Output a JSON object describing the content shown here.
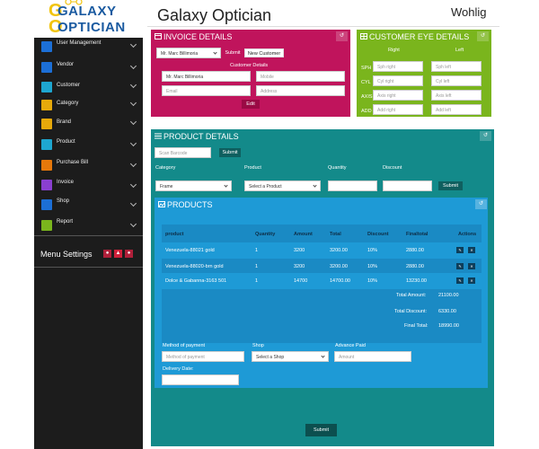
{
  "brand": {
    "logo_line1": "GALAXY",
    "logo_line2": "OPTICIAN"
  },
  "header": {
    "title": "Galaxy Optician",
    "user": "Wohlig"
  },
  "sidebar": {
    "items": [
      {
        "label": "User Management",
        "color": "#1c6fd6"
      },
      {
        "label": "Vendor",
        "color": "#1c6fd6"
      },
      {
        "label": "Customer",
        "color": "#1ea6d0"
      },
      {
        "label": "Category",
        "color": "#e6a90b"
      },
      {
        "label": "Brand",
        "color": "#e6a90b"
      },
      {
        "label": "Product",
        "color": "#1ea6d0"
      },
      {
        "label": "Purchase Bill",
        "color": "#e6780b"
      },
      {
        "label": "Invoice",
        "color": "#8a3fd0"
      },
      {
        "label": "Shop",
        "color": "#1c6fd6"
      },
      {
        "label": "Report",
        "color": "#7ab51d"
      }
    ],
    "menu_settings": "Menu Settings"
  },
  "invoice": {
    "title": "INVOICE DETAILS",
    "customer_select": "Mr. Marc Billimoria",
    "submit_label": "Submit",
    "new_customer_label": "New Customer",
    "customer_details_label": "Customer Details",
    "name_value": "Mr. Marc Billimoria",
    "mobile_placeholder": "Mobile",
    "email_placeholder": "Email",
    "address_placeholder": "Address",
    "edit_label": "Edit"
  },
  "eye": {
    "title": "CUSTOMER EYE DETAILS",
    "right_label": "Right",
    "left_label": "Left",
    "rows": [
      {
        "label": "SPH",
        "right_ph": "Sph right",
        "left_ph": "Sph left"
      },
      {
        "label": "CYL",
        "right_ph": "Cyl right",
        "left_ph": "Cyl left"
      },
      {
        "label": "AXIS",
        "right_ph": "Axis right",
        "left_ph": "Axis left"
      },
      {
        "label": "ADD",
        "right_ph": "Add right",
        "left_ph": "Add left"
      }
    ]
  },
  "product_details": {
    "title": "PRODUCT DETAILS",
    "scan_placeholder": "Scan Barcode",
    "submit_label": "Submit",
    "category_label": "Category",
    "product_label": "Product",
    "quantity_label": "Quantity",
    "discount_label": "Discount",
    "category_value": "Frame",
    "product_value": "Select a Product",
    "submit2_label": "Submit"
  },
  "products": {
    "title": "PRODUCTS",
    "headers": [
      "product",
      "Quantity",
      "Amount",
      "Total",
      "Discount",
      "Finaltotal",
      "Actions"
    ],
    "rows": [
      [
        "Venezuela-88021 gold",
        "1",
        "3200",
        "3200.00",
        "10%",
        "2880.00"
      ],
      [
        "Venezuela-88020-brn gold",
        "1",
        "3200",
        "3200.00",
        "10%",
        "2880.00"
      ],
      [
        "Dolce & Gabanna-3163 501",
        "1",
        "14700",
        "14700.00",
        "10%",
        "13230.00"
      ]
    ],
    "total_amount_label": "Total Amount:",
    "total_amount": "21100.00",
    "total_discount_label": "Total Discount:",
    "total_discount": "6330.00",
    "final_total_label": "Final Total:",
    "final_total": "18990.00",
    "method_label": "Method of payment",
    "method_placeholder": "Method of payment",
    "shop_label": "Shop",
    "shop_value": "Select a Shop",
    "advance_label": "Advance Paid",
    "advance_placeholder": "Amount",
    "delivery_label": "Delivery Date:",
    "final_submit_label": "Submit"
  }
}
